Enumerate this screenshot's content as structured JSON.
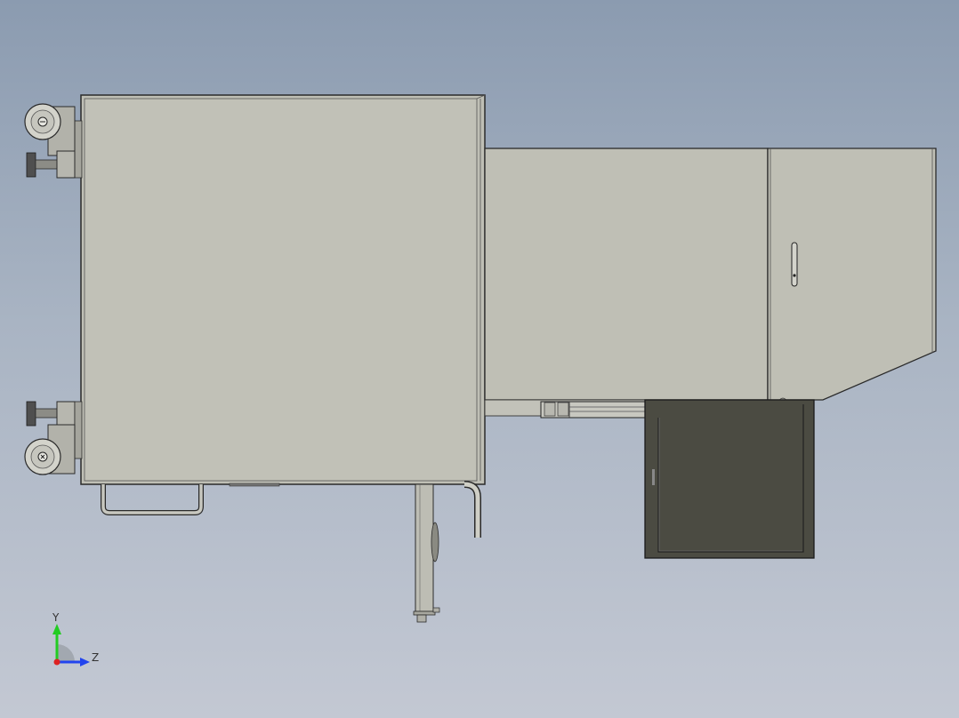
{
  "viewport": {
    "background_top": "#8b9bb0",
    "background_bottom": "#c3c8d3",
    "body_color": "#bfbfb5",
    "dark_panel_color": "#4b4b42",
    "edge_color": "#2a2a2a"
  },
  "triad": {
    "y_label": "Y",
    "z_label": "Z",
    "y_color": "#22cc22",
    "z_color": "#2244ee",
    "x_color": "#dd2222"
  }
}
